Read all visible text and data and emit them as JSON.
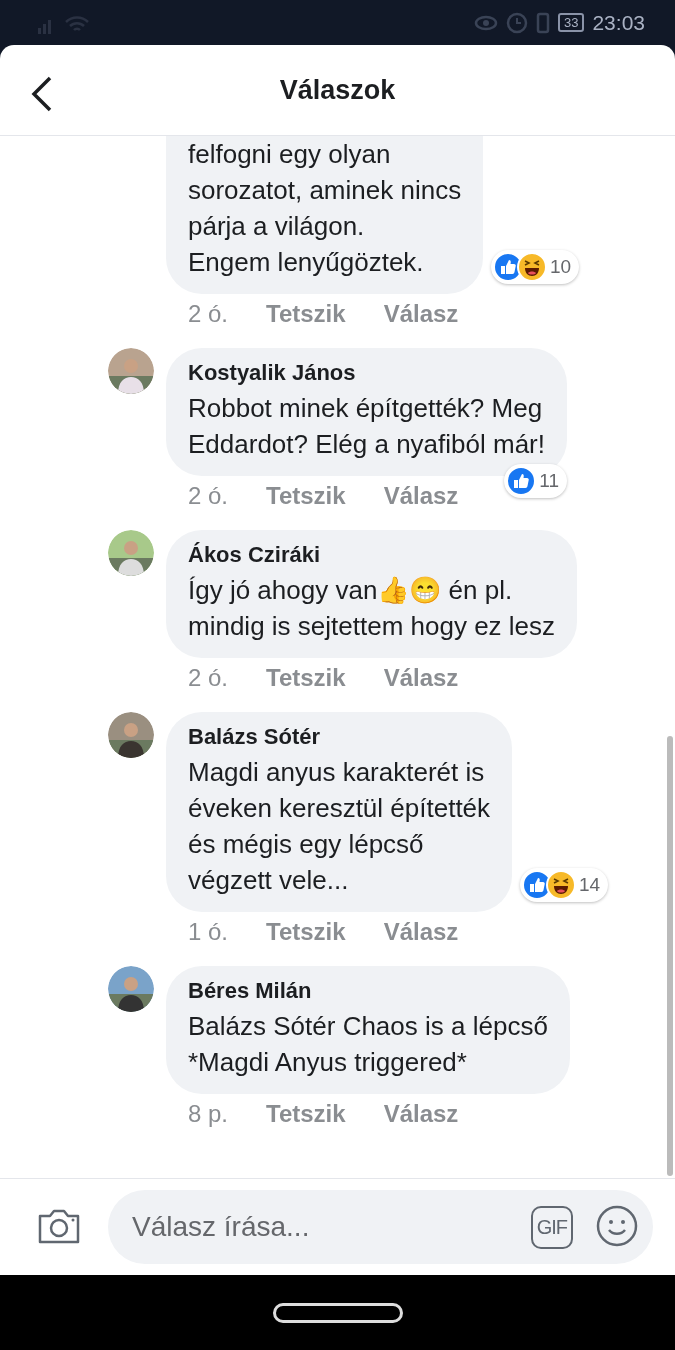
{
  "status_bar": {
    "battery": "33",
    "time": "23:03"
  },
  "header": {
    "title": "Válaszok"
  },
  "comments": [
    {
      "text": "felfogni egy olyan\nsorozatot, aminek nincs\npárja a világon.\nEngem lenyűgöztek.",
      "time": "2 ó.",
      "like": "Tetszik",
      "reply": "Válasz",
      "reactions": [
        {
          "kind": "like"
        },
        {
          "kind": "haha"
        }
      ],
      "reaction_count": "10"
    },
    {
      "author": "Kostyalik János",
      "text": "Robbot minek építgették? Meg\nEddardot? Elég a nyafiból már!",
      "time": "2 ó.",
      "like": "Tetszik",
      "reply": "Válasz",
      "reactions": [
        {
          "kind": "like"
        }
      ],
      "reaction_count": "11"
    },
    {
      "author": "Ákos Cziráki",
      "text": "Így jó ahogy van👍😁 én pl.\nmindig is sejtettem hogy ez lesz",
      "time": "2 ó.",
      "like": "Tetszik",
      "reply": "Válasz"
    },
    {
      "author": "Balázs Sótér",
      "text": "Magdi anyus karakterét is\néveken keresztül építették\nés mégis egy lépcső\nvégzett vele...",
      "time": "1 ó.",
      "like": "Tetszik",
      "reply": "Válasz",
      "reactions": [
        {
          "kind": "like"
        },
        {
          "kind": "haha"
        }
      ],
      "reaction_count": "14"
    },
    {
      "author": "Béres Milán",
      "text": "Balázs Sótér Chaos is a lépcső\n*Magdi Anyus triggered*",
      "time": "8 p.",
      "like": "Tetszik",
      "reply": "Válasz"
    }
  ],
  "composer": {
    "placeholder": "Válasz írása...",
    "gif": "GIF"
  }
}
